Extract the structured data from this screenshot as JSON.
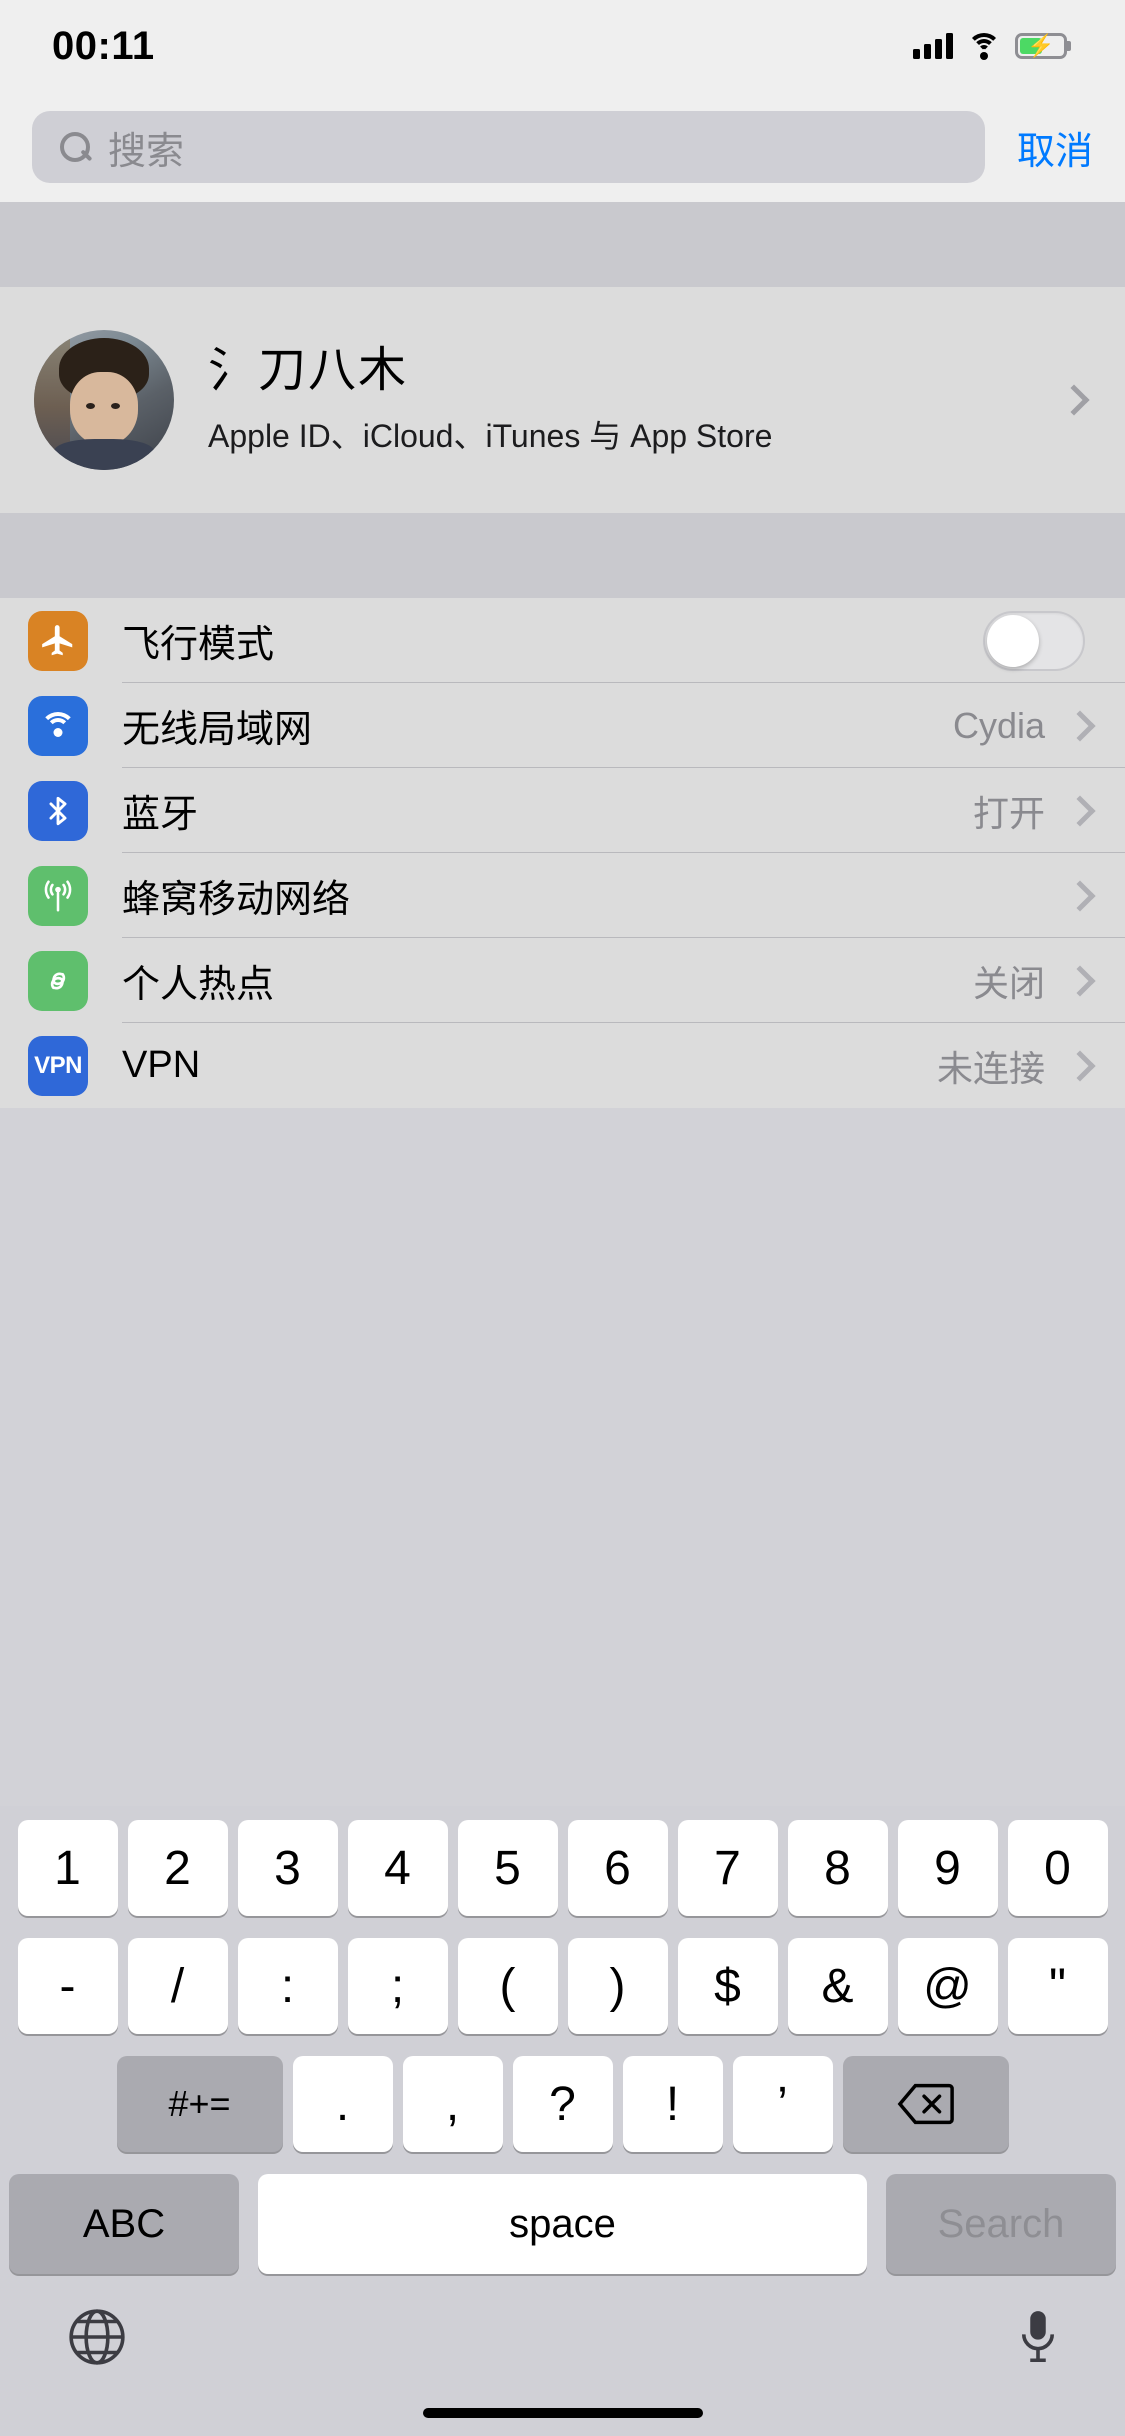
{
  "status_bar": {
    "time": "00:11",
    "signal_icon": "cellular-signal-icon",
    "wifi_icon": "wifi-icon",
    "battery_icon": "battery-charging-icon"
  },
  "search": {
    "placeholder": "搜索",
    "value": "",
    "icon": "search-icon",
    "cancel_label": "取消"
  },
  "profile": {
    "name": "氵刀八木",
    "subtitle": "Apple ID、iCloud、iTunes 与 App Store",
    "avatar": "user-avatar-photo",
    "chevron": "chevron-right-icon"
  },
  "settings": {
    "rows": [
      {
        "label": "飞行模式",
        "value": "",
        "icon": "airplane-icon",
        "icon_color": "#d98324",
        "control": "toggle",
        "toggle_on": false,
        "chevron": false
      },
      {
        "label": "无线局域网",
        "value": "Cydia",
        "icon": "wifi-icon",
        "icon_color": "#2a6fdb",
        "control": "disclosure",
        "chevron": true
      },
      {
        "label": "蓝牙",
        "value": "打开",
        "icon": "bluetooth-icon",
        "icon_color": "#2f68d8",
        "control": "disclosure",
        "chevron": true
      },
      {
        "label": "蜂窝移动网络",
        "value": "",
        "icon": "cellular-icon",
        "icon_color": "#5fbf6d",
        "control": "disclosure",
        "chevron": true
      },
      {
        "label": "个人热点",
        "value": "关闭",
        "icon": "hotspot-icon",
        "icon_color": "#5fbf6d",
        "control": "disclosure",
        "chevron": true
      },
      {
        "label": "VPN",
        "value": "未连接",
        "icon": "vpn-icon",
        "icon_color": "#2f68d8",
        "icon_text": "VPN",
        "control": "disclosure",
        "chevron": true
      }
    ]
  },
  "keyboard": {
    "layout": "numeric-symbols",
    "row1": [
      "1",
      "2",
      "3",
      "4",
      "5",
      "6",
      "7",
      "8",
      "9",
      "0"
    ],
    "row2": [
      "-",
      "/",
      ":",
      ";",
      "(",
      ")",
      "$",
      "&",
      "@",
      "\""
    ],
    "row3": {
      "shift_label": "#+=",
      "keys": [
        ".",
        ",",
        "?",
        "!",
        "’"
      ],
      "backspace_icon": "backspace-icon"
    },
    "row4": {
      "abc_label": "ABC",
      "space_label": "space",
      "return_label": "Search"
    },
    "globe_icon": "globe-icon",
    "mic_icon": "microphone-icon"
  },
  "colors": {
    "accent_blue": "#007aff",
    "background": "#dcdcdc",
    "keyboard_bg": "#d0d0d6",
    "separator": "#c9c9ce"
  }
}
